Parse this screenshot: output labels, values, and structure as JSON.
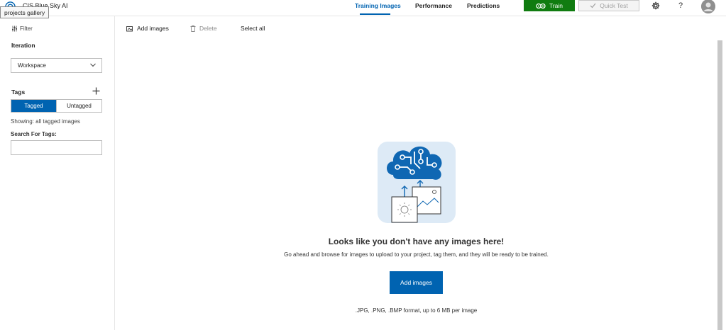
{
  "app": {
    "title": "CIS Blue Sky AI",
    "tooltip": "projects gallery"
  },
  "nav": {
    "tabs": [
      {
        "label": "Training Images",
        "active": true
      },
      {
        "label": "Performance",
        "active": false
      },
      {
        "label": "Predictions",
        "active": false
      }
    ],
    "train_label": "Train",
    "quick_test_label": "Quick Test",
    "settings_icon": "gear-icon",
    "help_label": "?"
  },
  "toolbar": {
    "add_images_label": "Add images",
    "delete_label": "Delete",
    "select_all_label": "Select all"
  },
  "sidebar": {
    "filter_label": "Filter",
    "iteration_label": "Iteration",
    "iteration_value": "Workspace",
    "tags_label": "Tags",
    "tagged_label": "Tagged",
    "untagged_label": "Untagged",
    "showing_text": "Showing: all tagged images",
    "search_label": "Search For Tags:",
    "search_value": ""
  },
  "empty_state": {
    "title": "Looks like you don't have any images here!",
    "description": "Go ahead and browse for images to upload to your project, tag them, and they will be ready to be trained.",
    "button_label": "Add images",
    "formats_text": ".JPG, .PNG, .BMP format, up to 6 MB per image"
  },
  "colors": {
    "accent": "#0063b1",
    "train": "#107c10"
  }
}
